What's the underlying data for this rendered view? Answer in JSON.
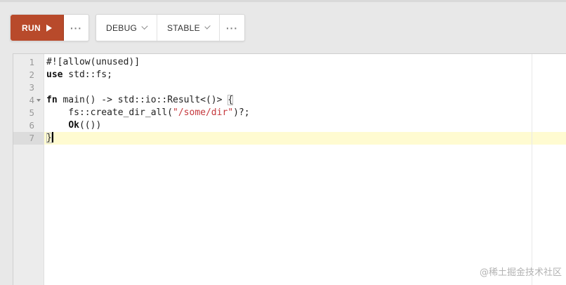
{
  "toolbar": {
    "run_label": "RUN",
    "more_label": "···",
    "debug_label": "DEBUG",
    "stable_label": "STABLE",
    "accent_color": "#b84a2b"
  },
  "editor": {
    "line_numbers": [
      "1",
      "2",
      "3",
      "4",
      "5",
      "6",
      "7"
    ],
    "active_line": 7,
    "lines": {
      "l1": "#![allow(unused)]",
      "l2_kw": "use",
      "l2_rest": " std::fs;",
      "l4_kw": "fn",
      "l4_rest": " main() -> std::io::Result<()> ",
      "l4_brace": "{",
      "l5_a": "    fs::create_dir_all(",
      "l5_str": "\"/some/dir\"",
      "l5_b": ")?;",
      "l6_indent": "    ",
      "l6_kw": "Ok",
      "l6_rest": "(())",
      "l7": "}"
    }
  },
  "watermark": "@稀土掘金技术社区"
}
